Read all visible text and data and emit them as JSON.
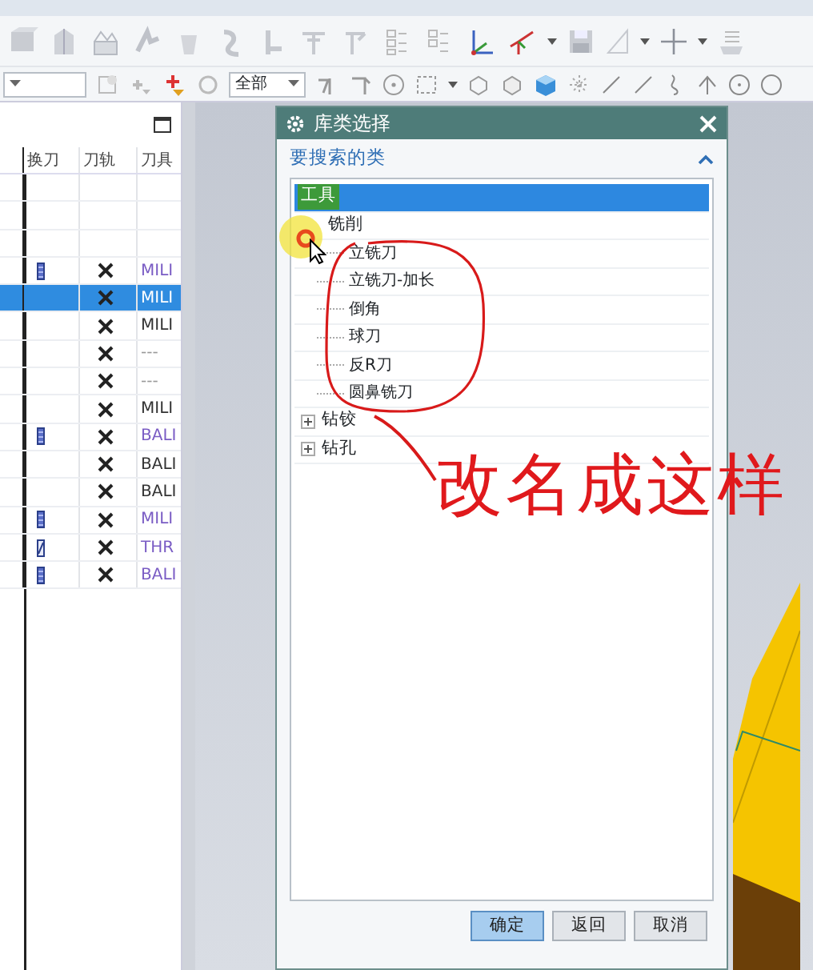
{
  "toolbar": {
    "filter_dropdown": {
      "value": "全部"
    }
  },
  "operation_panel": {
    "columns": [
      "换刀",
      "刀轨",
      "刀具"
    ],
    "rows": [
      {
        "kind": "blank",
        "selected": false
      },
      {
        "kind": "blank",
        "selected": false
      },
      {
        "kind": "blank",
        "selected": false
      },
      {
        "kind": "operation",
        "tool_change": true,
        "modified": false,
        "tool": "MILI",
        "color": "#7a5cc4",
        "selected": false
      },
      {
        "kind": "operation",
        "tool_change": false,
        "tool": "MILI",
        "selected": true
      },
      {
        "kind": "operation",
        "tool_change": false,
        "tool": "MILI",
        "color": "#333333",
        "selected": false
      },
      {
        "kind": "operation",
        "tool_change": false,
        "tool": "---",
        "color": "#999999",
        "selected": false
      },
      {
        "kind": "operation",
        "tool_change": false,
        "tool": "---",
        "color": "#999999",
        "selected": false
      },
      {
        "kind": "operation",
        "tool_change": false,
        "tool": "MILI",
        "color": "#333333",
        "selected": false
      },
      {
        "kind": "operation",
        "tool_change": true,
        "modified": false,
        "tool": "BALI",
        "color": "#7a5cc4",
        "selected": false
      },
      {
        "kind": "operation",
        "tool_change": false,
        "tool": "BALI",
        "color": "#333333",
        "selected": false
      },
      {
        "kind": "operation",
        "tool_change": false,
        "tool": "BALI",
        "color": "#333333",
        "selected": false
      },
      {
        "kind": "operation",
        "tool_change": true,
        "modified": false,
        "tool": "MILI",
        "color": "#7a5cc4",
        "selected": false
      },
      {
        "kind": "operation",
        "tool_change": true,
        "modified": true,
        "tool": "THR",
        "color": "#7a5cc4",
        "selected": false
      },
      {
        "kind": "operation",
        "tool_change": true,
        "modified": false,
        "tool": "BALI",
        "color": "#7a5cc4",
        "selected": false
      }
    ]
  },
  "dialog": {
    "title": "库类选择",
    "section": {
      "title": "要搜索的类",
      "expanded": true
    },
    "tree": [
      {
        "label": "工具",
        "selected": true,
        "expanded": true,
        "children": [
          {
            "label": "铣削",
            "selected": false,
            "expanded": true,
            "children": [
              {
                "label": "立铣刀",
                "selected": false
              },
              {
                "label": "立铣刀-加长",
                "selected": false
              },
              {
                "label": "倒角",
                "selected": false
              },
              {
                "label": "球刀",
                "selected": false
              },
              {
                "label": "反R刀",
                "selected": false
              },
              {
                "label": "圆鼻铣刀",
                "selected": false
              }
            ]
          },
          {
            "label": "钻铰",
            "selected": false,
            "expanded": false
          },
          {
            "label": "钻孔",
            "selected": false,
            "expanded": false
          }
        ]
      }
    ],
    "buttons": [
      {
        "label": "确定",
        "default": true
      },
      {
        "label": "返回",
        "default": false
      },
      {
        "label": "取消",
        "default": false
      }
    ]
  },
  "annotation": {
    "text": "改名成这样"
  }
}
